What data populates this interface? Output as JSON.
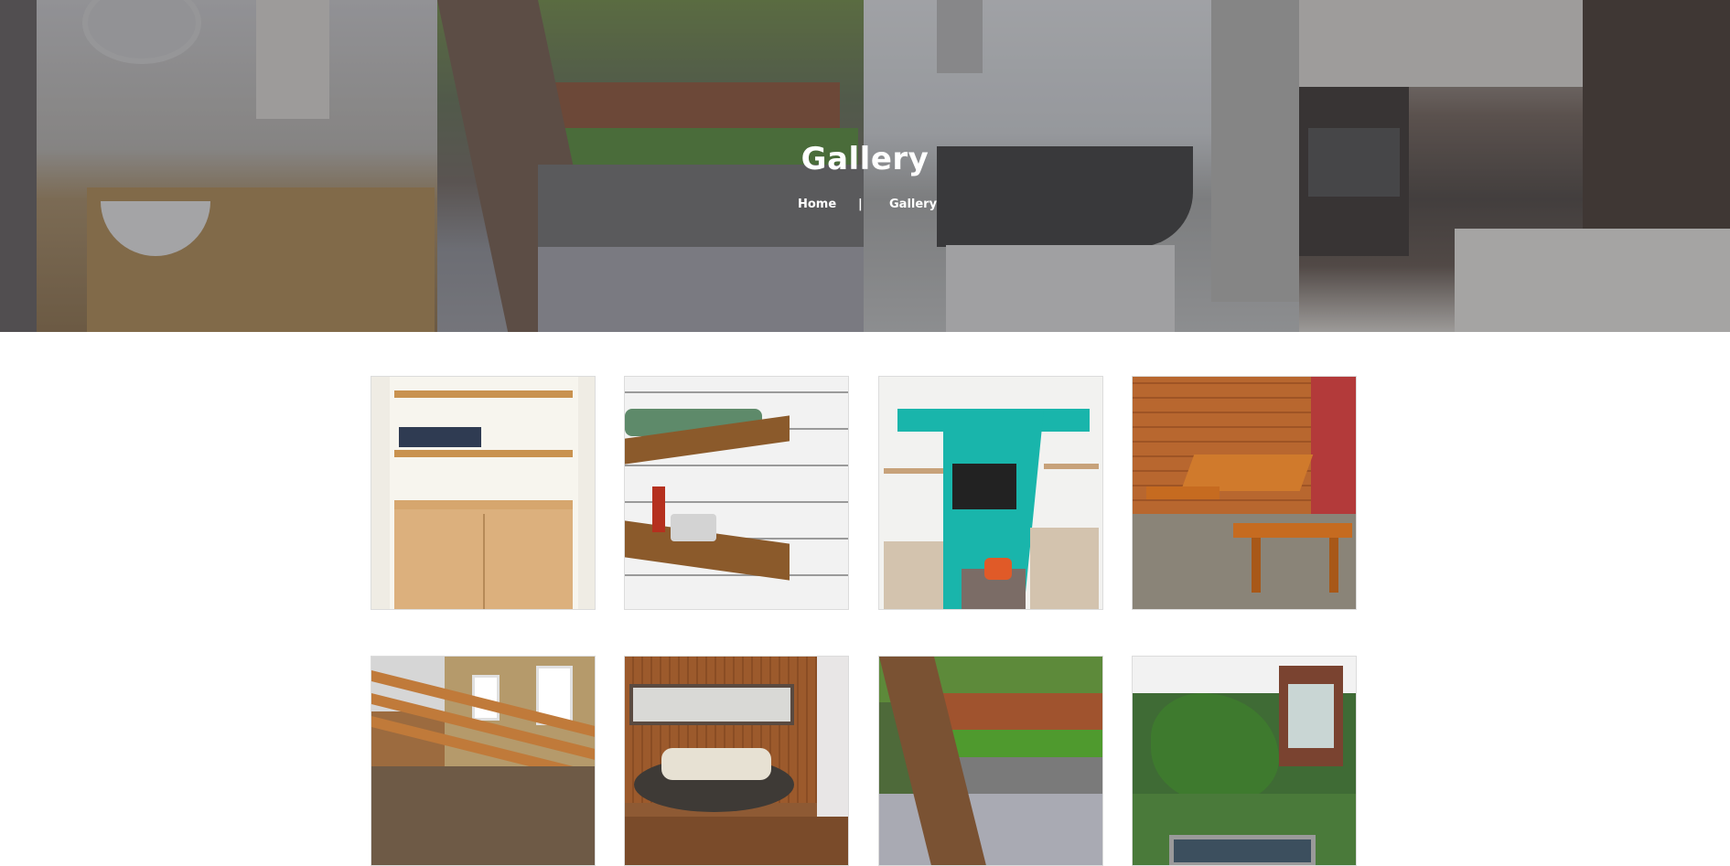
{
  "hero": {
    "title": "Gallery",
    "breadcrumb": {
      "home": "Home",
      "separator": "|",
      "current": "Gallery"
    }
  },
  "gallery": {
    "items": [
      {
        "subject": "built-in shelves with cabinets"
      },
      {
        "subject": "wooden wall shelves in kitchen"
      },
      {
        "subject": "teal wall with tv and alcove shelves"
      },
      {
        "subject": "pine dining table with benches"
      },
      {
        "subject": "horizontal slat fence on brick wall"
      },
      {
        "subject": "wooden cladding with round daybed"
      },
      {
        "subject": "terraced garden with steps"
      },
      {
        "subject": "garden pond with summer house"
      }
    ]
  },
  "colors": {
    "hero_overlay": "#46464b",
    "hero_text": "#ffffff",
    "page_background": "#ffffff",
    "tile_border": "#dcdcdc"
  }
}
